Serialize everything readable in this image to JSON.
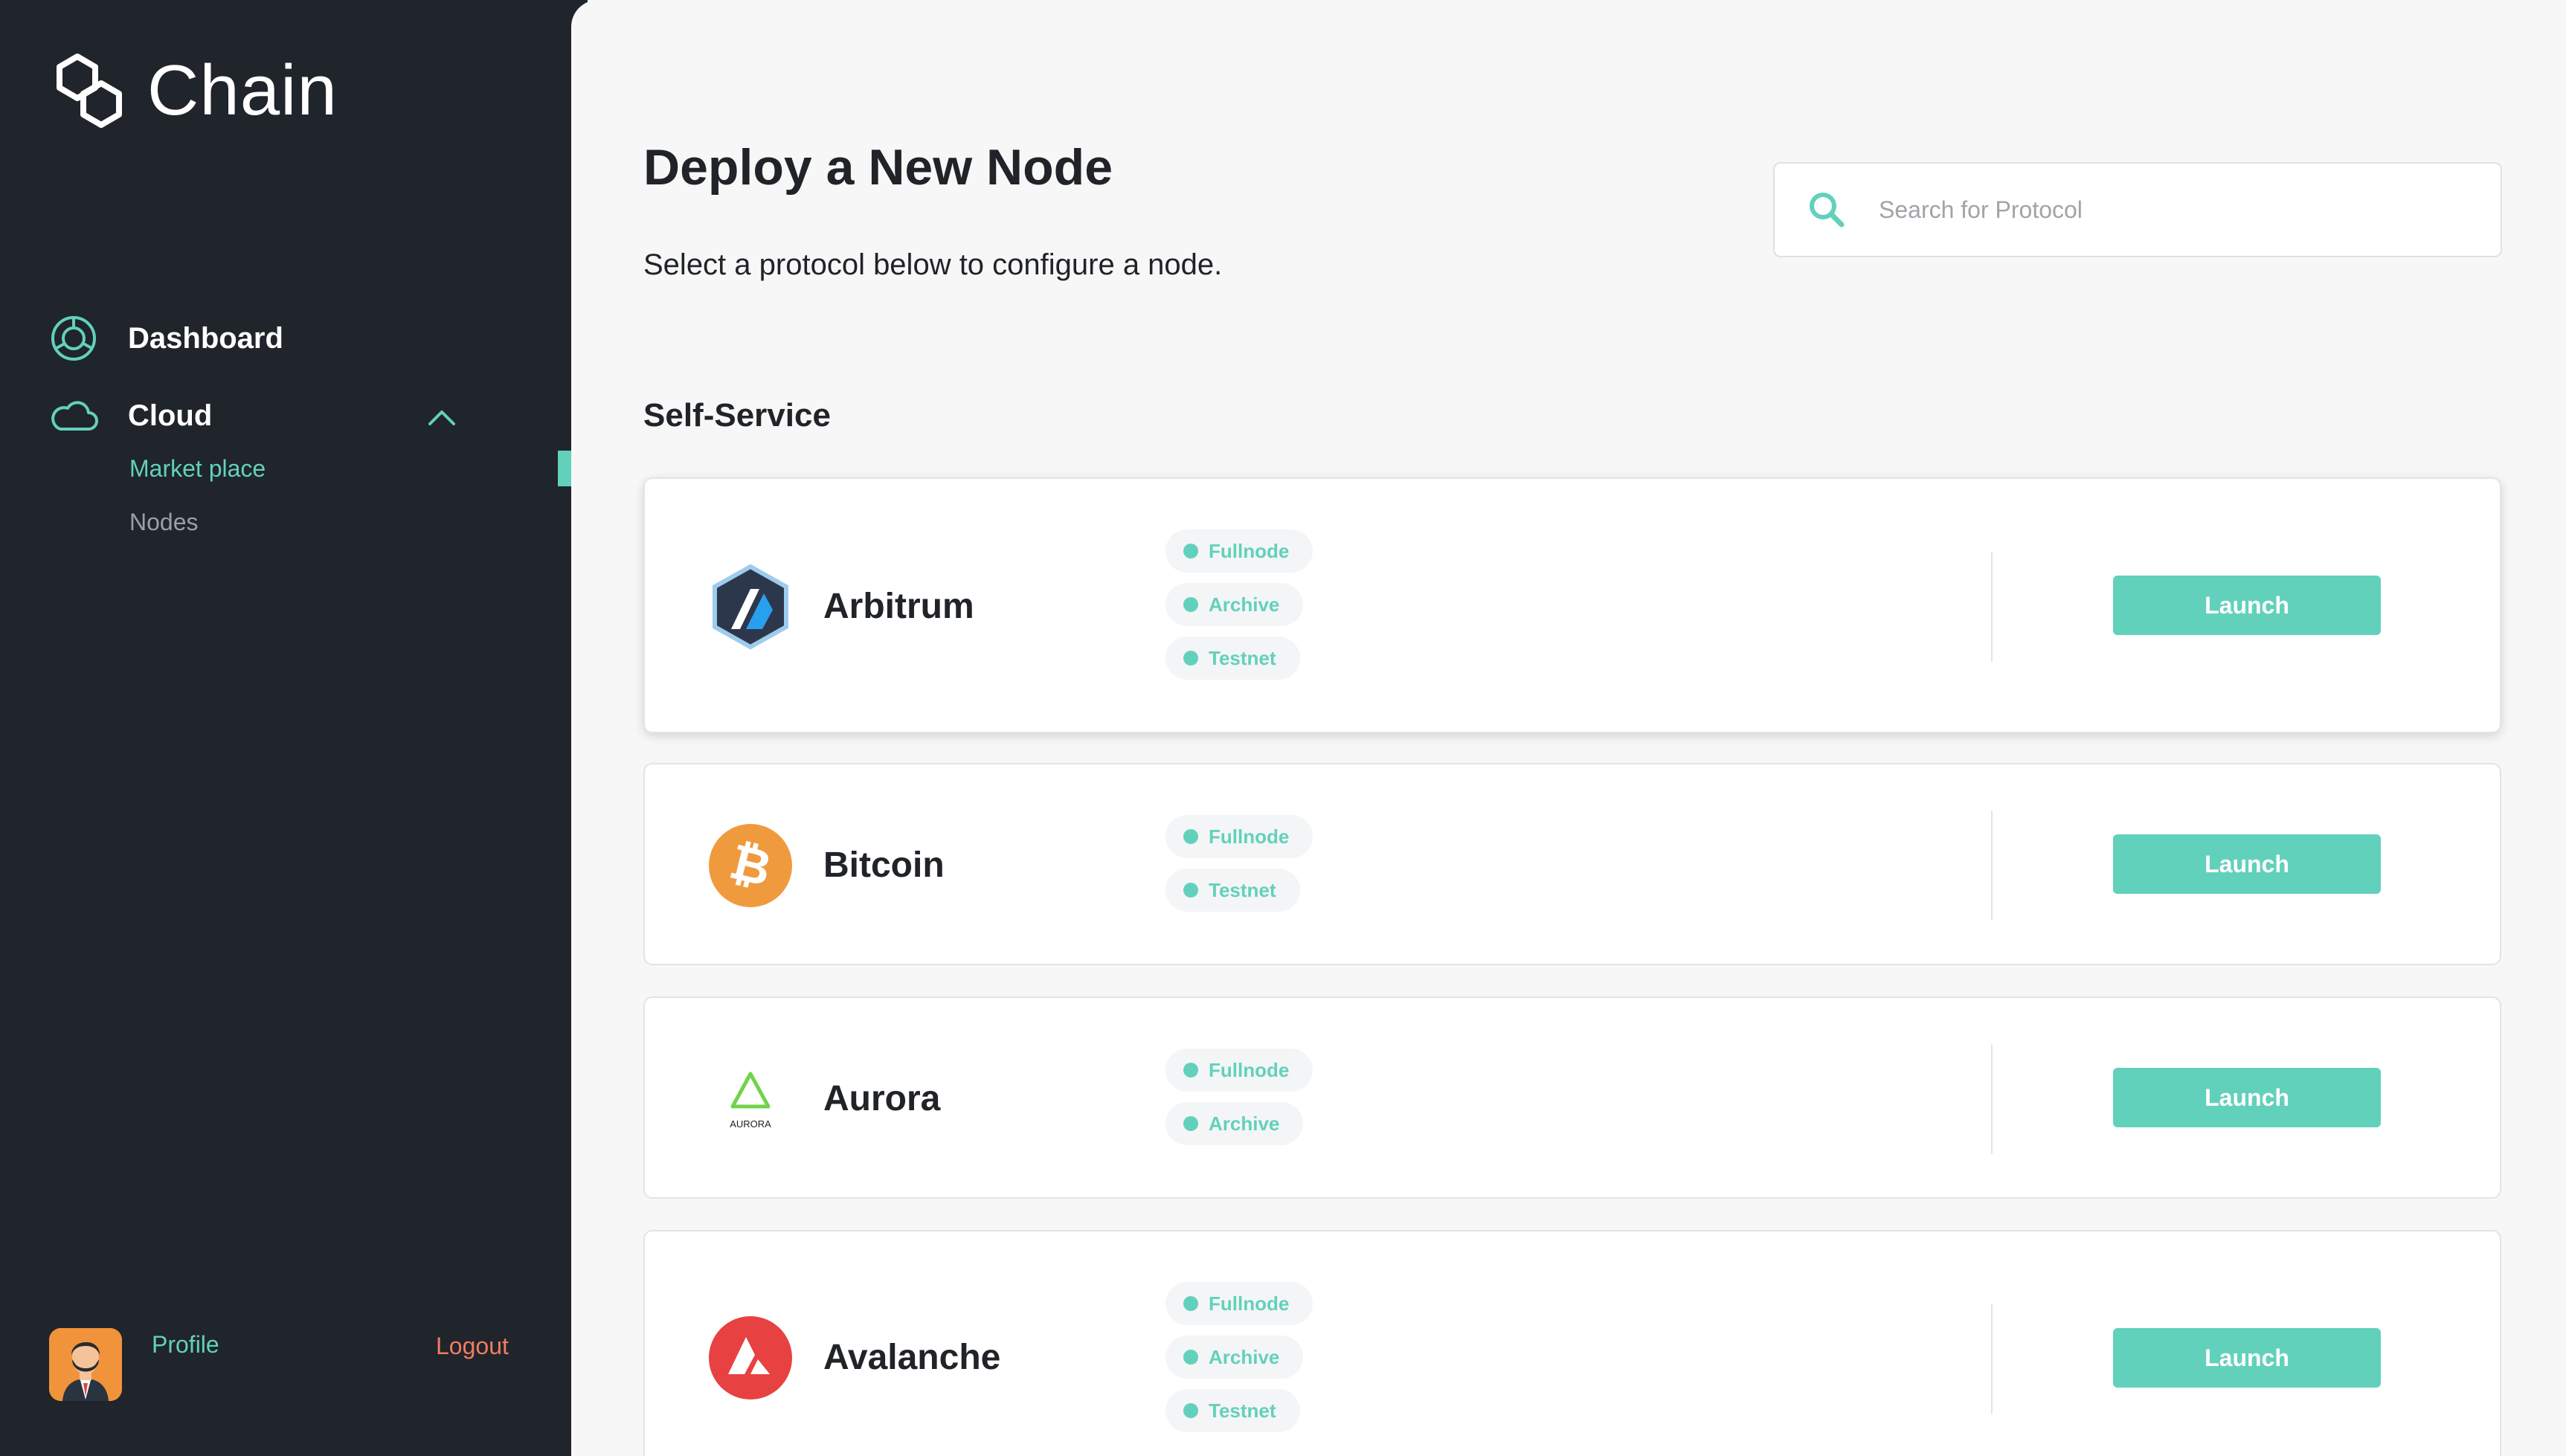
{
  "app": {
    "brand": "Chain"
  },
  "sidebar": {
    "nav": [
      {
        "label": "Dashboard",
        "icon": "dashboard-icon"
      },
      {
        "label": "Cloud",
        "icon": "cloud-icon"
      }
    ],
    "cloud_sub": [
      {
        "label": "Market place",
        "active": true
      },
      {
        "label": "Nodes",
        "active": false
      }
    ],
    "profile_label": "Profile",
    "logout_label": "Logout"
  },
  "main": {
    "title": "Deploy a New Node",
    "subtitle": "Select a protocol below to configure a node.",
    "search": {
      "placeholder": "Search for Protocol",
      "value": "",
      "icon": "search-icon"
    },
    "section_title": "Self-Service",
    "protocols": [
      {
        "name": "Arbitrum",
        "logo": "arbitrum-logo",
        "tags": [
          "Fullnode",
          "Archive",
          "Testnet"
        ],
        "button": "Launch"
      },
      {
        "name": "Bitcoin",
        "logo": "bitcoin-logo",
        "tags": [
          "Fullnode",
          "Testnet"
        ],
        "button": "Launch"
      },
      {
        "name": "Aurora",
        "logo": "aurora-logo",
        "logo_text": "AURORA",
        "tags": [
          "Fullnode",
          "Archive"
        ],
        "button": "Launch"
      },
      {
        "name": "Avalanche",
        "logo": "avalanche-logo",
        "tags": [
          "Fullnode",
          "Archive",
          "Testnet"
        ],
        "button": "Launch"
      }
    ]
  },
  "colors": {
    "accent": "#62d1bb",
    "sidebar_bg": "#20242b",
    "page_bg": "#f7f7f7",
    "logout": "#f07c62",
    "bitcoin": "#f09a3e",
    "avalanche": "#e84142",
    "aurora": "#70d44b"
  }
}
